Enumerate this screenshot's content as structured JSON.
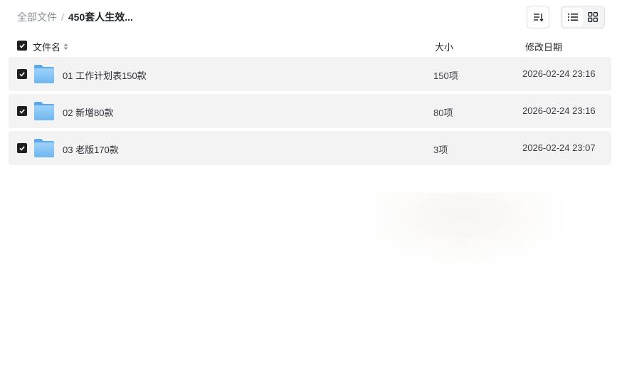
{
  "breadcrumb": {
    "root": "全部文件",
    "separator": "/",
    "current": "450套人生效..."
  },
  "toolbar": {
    "sort_icon": "sort-icon",
    "list_view_icon": "list-view-icon",
    "grid_view_icon": "grid-view-icon",
    "active_view": "list"
  },
  "table": {
    "headers": {
      "name": "文件名",
      "size": "大小",
      "date": "修改日期"
    },
    "rows": [
      {
        "name": "01 工作计划表150款",
        "size": "150项",
        "date": "2026-02-24 23:16",
        "checked": true
      },
      {
        "name": "02 新增80款",
        "size": "80项",
        "date": "2026-02-24 23:16",
        "checked": true
      },
      {
        "name": "03 老版170款",
        "size": "3项",
        "date": "2026-02-24 23:07",
        "checked": true
      }
    ]
  },
  "colors": {
    "row_background": "#f3f3f4",
    "checkbox": "#1f1f1f",
    "folder": "#7cc0f4"
  }
}
